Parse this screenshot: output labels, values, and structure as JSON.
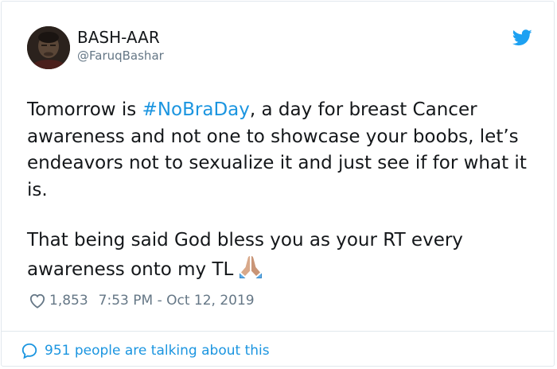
{
  "author": {
    "display_name": "BASH-AAR",
    "handle": "@FaruqBashar",
    "avatar_icon": "profile-photo"
  },
  "brand": {
    "icon": "twitter-bird-icon",
    "color": "#1da1f2"
  },
  "tweet": {
    "text_before_hashtag": "Tomorrow is ",
    "hashtag": "#NoBraDay",
    "text_after_hashtag": ", a day for breast Cancer awareness and not one to showcase your boobs, let’s endeavors not to sexualize it and just see if for what it is.",
    "second_paragraph": "That being said God bless you as your RT every awareness onto my TL",
    "emoji": "folded-hands-icon"
  },
  "meta": {
    "like_count": "1,853",
    "timestamp": "7:53 PM - Oct 12, 2019"
  },
  "footer": {
    "talking_text": "951 people are talking about this"
  },
  "colors": {
    "link": "#1b95e0",
    "secondary_text": "#657786",
    "border": "#e1e8ed"
  }
}
